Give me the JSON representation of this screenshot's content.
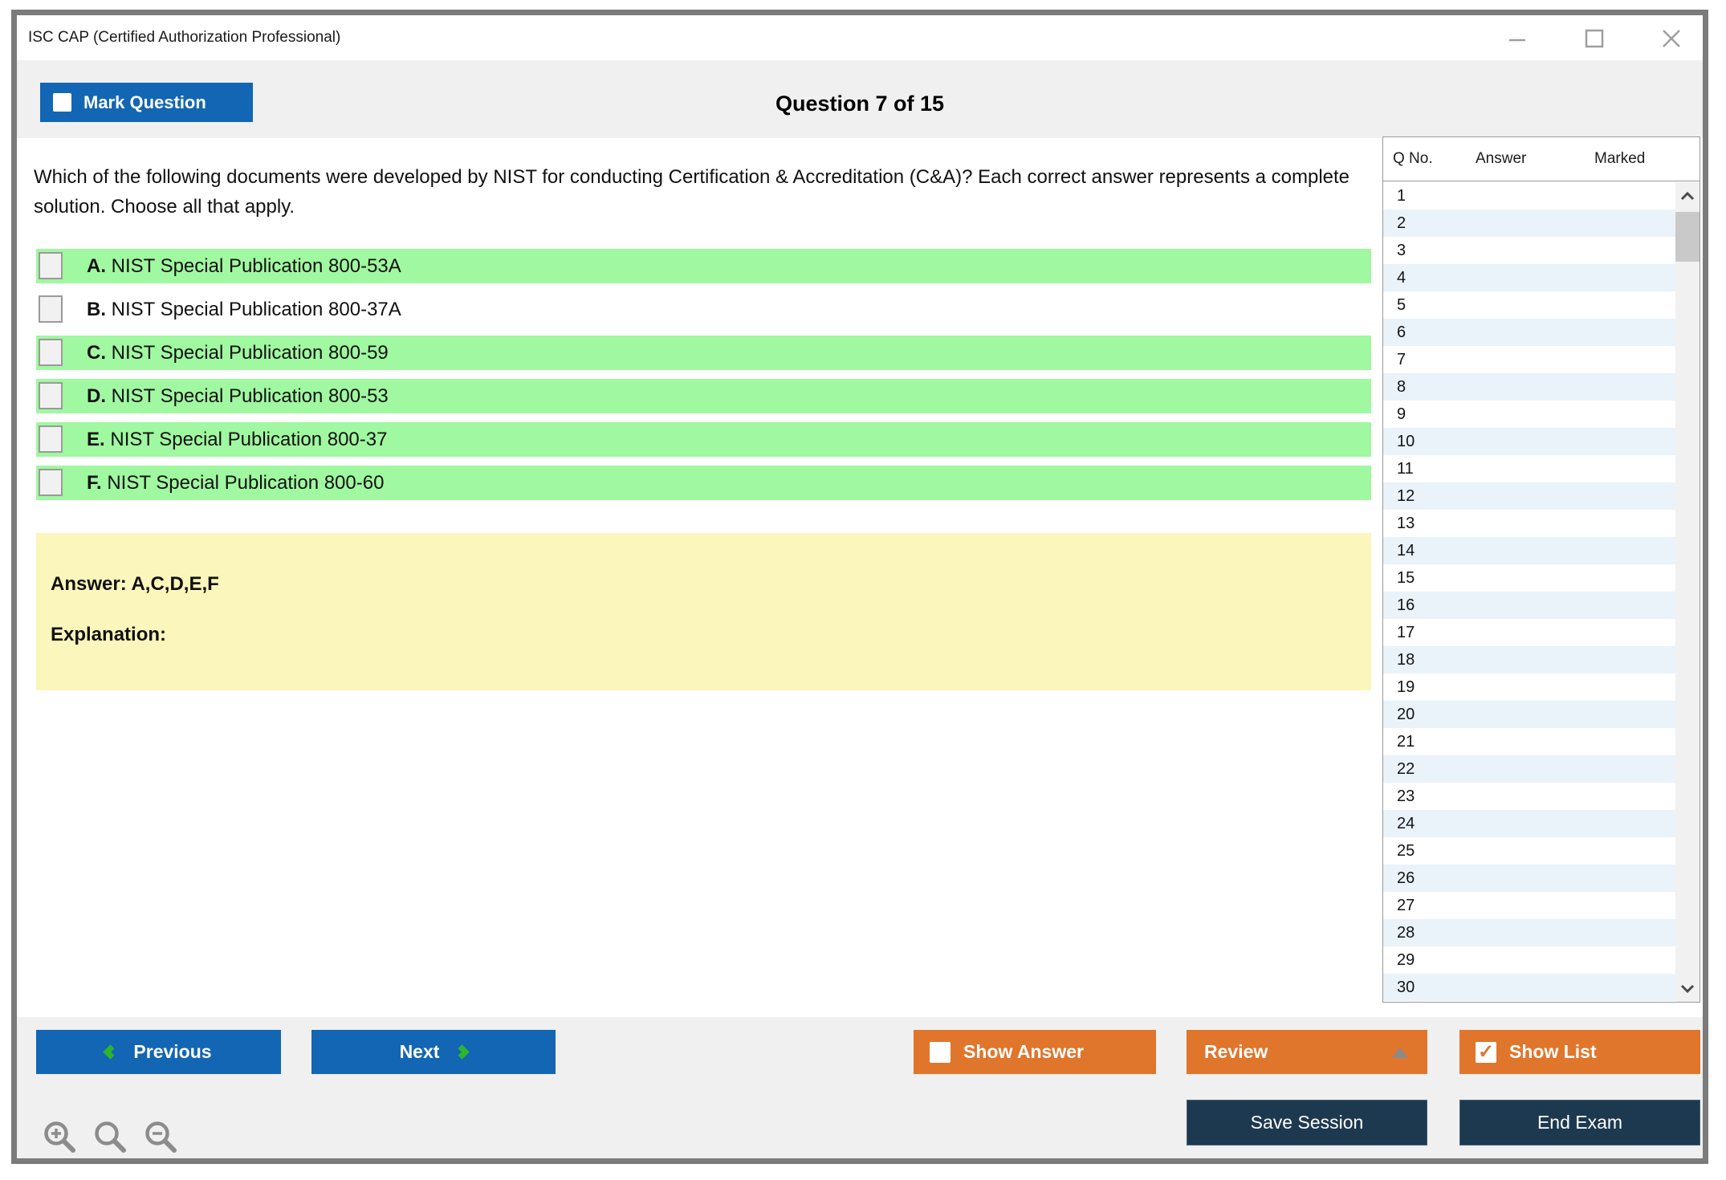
{
  "colors": {
    "accent-blue": "#1266b3",
    "accent-orange": "#e0762c",
    "accent-navy": "#1d3950",
    "option-green": "#a0f8a0",
    "answer-yellow": "#fbf6bb",
    "row-stripe": "#eaf2fa",
    "chevron-green": "#2db52d"
  },
  "window": {
    "title": "ISC CAP (Certified Authorization Professional)",
    "controls": {
      "minimize": "minimize",
      "maximize": "maximize",
      "close": "close"
    }
  },
  "header": {
    "mark_question_label": "Mark Question",
    "question_counter": "Question 7 of 15"
  },
  "question": {
    "text": "Which of the following documents were developed by NIST for conducting Certification & Accreditation (C&A)? Each correct answer represents a complete solution. Choose all that apply.",
    "options": [
      {
        "letter": "A.",
        "text": "NIST Special Publication 800-53A",
        "highlighted": true,
        "checked": false
      },
      {
        "letter": "B.",
        "text": "NIST Special Publication 800-37A",
        "highlighted": false,
        "checked": false
      },
      {
        "letter": "C.",
        "text": "NIST Special Publication 800-59",
        "highlighted": true,
        "checked": false
      },
      {
        "letter": "D.",
        "text": "NIST Special Publication 800-53",
        "highlighted": true,
        "checked": false
      },
      {
        "letter": "E.",
        "text": "NIST Special Publication 800-37",
        "highlighted": true,
        "checked": false
      },
      {
        "letter": "F.",
        "text": "NIST Special Publication 800-60",
        "highlighted": true,
        "checked": false
      }
    ]
  },
  "answer_panel": {
    "answer_label": "Answer: A,C,D,E,F",
    "explanation_label": "Explanation:"
  },
  "question_list": {
    "columns": {
      "q_no": "Q No.",
      "answer": "Answer",
      "marked": "Marked"
    },
    "rows": [
      {
        "q_no": "1",
        "answer": "",
        "marked": ""
      },
      {
        "q_no": "2",
        "answer": "",
        "marked": ""
      },
      {
        "q_no": "3",
        "answer": "",
        "marked": ""
      },
      {
        "q_no": "4",
        "answer": "",
        "marked": ""
      },
      {
        "q_no": "5",
        "answer": "",
        "marked": ""
      },
      {
        "q_no": "6",
        "answer": "",
        "marked": ""
      },
      {
        "q_no": "7",
        "answer": "",
        "marked": ""
      },
      {
        "q_no": "8",
        "answer": "",
        "marked": ""
      },
      {
        "q_no": "9",
        "answer": "",
        "marked": ""
      },
      {
        "q_no": "10",
        "answer": "",
        "marked": ""
      },
      {
        "q_no": "11",
        "answer": "",
        "marked": ""
      },
      {
        "q_no": "12",
        "answer": "",
        "marked": ""
      },
      {
        "q_no": "13",
        "answer": "",
        "marked": ""
      },
      {
        "q_no": "14",
        "answer": "",
        "marked": ""
      },
      {
        "q_no": "15",
        "answer": "",
        "marked": ""
      },
      {
        "q_no": "16",
        "answer": "",
        "marked": ""
      },
      {
        "q_no": "17",
        "answer": "",
        "marked": ""
      },
      {
        "q_no": "18",
        "answer": "",
        "marked": ""
      },
      {
        "q_no": "19",
        "answer": "",
        "marked": ""
      },
      {
        "q_no": "20",
        "answer": "",
        "marked": ""
      },
      {
        "q_no": "21",
        "answer": "",
        "marked": ""
      },
      {
        "q_no": "22",
        "answer": "",
        "marked": ""
      },
      {
        "q_no": "23",
        "answer": "",
        "marked": ""
      },
      {
        "q_no": "24",
        "answer": "",
        "marked": ""
      },
      {
        "q_no": "25",
        "answer": "",
        "marked": ""
      },
      {
        "q_no": "26",
        "answer": "",
        "marked": ""
      },
      {
        "q_no": "27",
        "answer": "",
        "marked": ""
      },
      {
        "q_no": "28",
        "answer": "",
        "marked": ""
      },
      {
        "q_no": "29",
        "answer": "",
        "marked": ""
      },
      {
        "q_no": "30",
        "answer": "",
        "marked": ""
      }
    ],
    "icons": {
      "scroll_up": "chevron-up-icon",
      "scroll_down": "chevron-down-icon"
    }
  },
  "footer": {
    "previous_label": "Previous",
    "next_label": "Next",
    "show_answer_label": "Show Answer",
    "review_label": "Review",
    "show_list_label": "Show List",
    "show_list_check": "✓",
    "save_session_label": "Save Session",
    "end_exam_label": "End Exam",
    "zoom_icons": [
      "zoom-in",
      "zoom",
      "zoom-out"
    ]
  }
}
